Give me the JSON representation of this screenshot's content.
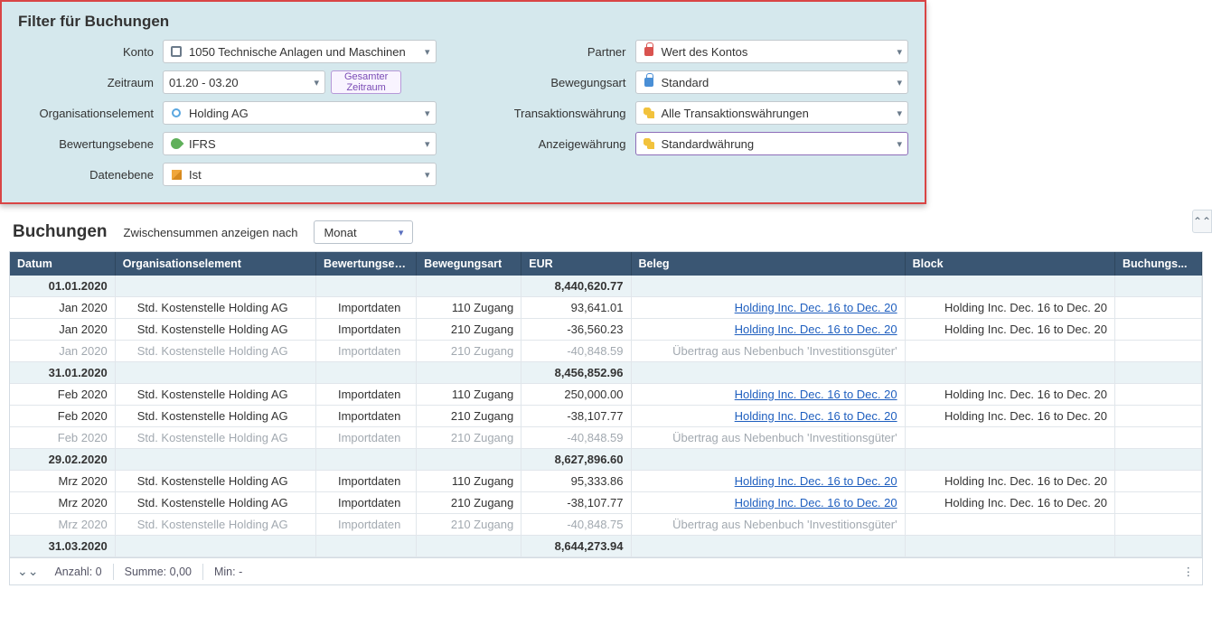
{
  "filter": {
    "title": "Filter für Buchungen",
    "konto": {
      "label": "Konto",
      "value": "1050 Technische Anlagen und Maschinen"
    },
    "zeitraum": {
      "label": "Zeitraum",
      "value": "01.20 - 03.20",
      "button_l1": "Gesamter",
      "button_l2": "Zeitraum"
    },
    "org": {
      "label": "Organisationselement",
      "value": "Holding AG"
    },
    "bewertung": {
      "label": "Bewertungsebene",
      "value": "IFRS"
    },
    "daten": {
      "label": "Datenebene",
      "value": "Ist"
    },
    "partner": {
      "label": "Partner",
      "value": "Wert des Kontos"
    },
    "bewegung": {
      "label": "Bewegungsart",
      "value": "Standard"
    },
    "trans": {
      "label": "Transaktionswährung",
      "value": "Alle Transaktionswährungen"
    },
    "anzeige": {
      "label": "Anzeigewährung",
      "value": "Standardwährung"
    }
  },
  "section": {
    "title": "Buchungen",
    "subtotal_label": "Zwischensummen anzeigen nach",
    "subtotal_value": "Monat"
  },
  "columns": [
    "Datum",
    "Organisationselement",
    "Bewertungseb...",
    "Bewegungsart",
    "EUR",
    "Beleg",
    "Block",
    "Buchungs..."
  ],
  "rows": [
    {
      "type": "subtotal",
      "datum": "01.01.2020",
      "eur": "8,440,620.77"
    },
    {
      "type": "data",
      "datum": "Jan 2020",
      "org": "Std. Kostenstelle Holding AG",
      "bew": "Importdaten",
      "art": "110 Zugang",
      "eur": "93,641.01",
      "beleg": "Holding Inc. Dec. 16 to Dec. 20",
      "block": "Holding Inc. Dec. 16 to Dec. 20"
    },
    {
      "type": "data",
      "datum": "Jan 2020",
      "org": "Std. Kostenstelle Holding AG",
      "bew": "Importdaten",
      "art": "210 Zugang",
      "eur": "-36,560.23",
      "beleg": "Holding Inc. Dec. 16 to Dec. 20",
      "block": "Holding Inc. Dec. 16 to Dec. 20"
    },
    {
      "type": "muted",
      "datum": "Jan 2020",
      "org": "Std. Kostenstelle Holding AG",
      "bew": "Importdaten",
      "art": "210 Zugang",
      "eur": "-40,848.59",
      "beleg": "Übertrag aus Nebenbuch 'Investitionsgüter'",
      "block": ""
    },
    {
      "type": "subtotal",
      "datum": "31.01.2020",
      "eur": "8,456,852.96"
    },
    {
      "type": "data",
      "datum": "Feb 2020",
      "org": "Std. Kostenstelle Holding AG",
      "bew": "Importdaten",
      "art": "110 Zugang",
      "eur": "250,000.00",
      "beleg": "Holding Inc. Dec. 16 to Dec. 20",
      "block": "Holding Inc. Dec. 16 to Dec. 20"
    },
    {
      "type": "data",
      "datum": "Feb 2020",
      "org": "Std. Kostenstelle Holding AG",
      "bew": "Importdaten",
      "art": "210 Zugang",
      "eur": "-38,107.77",
      "beleg": "Holding Inc. Dec. 16 to Dec. 20",
      "block": "Holding Inc. Dec. 16 to Dec. 20"
    },
    {
      "type": "muted",
      "datum": "Feb 2020",
      "org": "Std. Kostenstelle Holding AG",
      "bew": "Importdaten",
      "art": "210 Zugang",
      "eur": "-40,848.59",
      "beleg": "Übertrag aus Nebenbuch 'Investitionsgüter'",
      "block": ""
    },
    {
      "type": "subtotal",
      "datum": "29.02.2020",
      "eur": "8,627,896.60"
    },
    {
      "type": "data",
      "datum": "Mrz 2020",
      "org": "Std. Kostenstelle Holding AG",
      "bew": "Importdaten",
      "art": "110 Zugang",
      "eur": "95,333.86",
      "beleg": "Holding Inc. Dec. 16 to Dec. 20",
      "block": "Holding Inc. Dec. 16 to Dec. 20"
    },
    {
      "type": "data",
      "datum": "Mrz 2020",
      "org": "Std. Kostenstelle Holding AG",
      "bew": "Importdaten",
      "art": "210 Zugang",
      "eur": "-38,107.77",
      "beleg": "Holding Inc. Dec. 16 to Dec. 20",
      "block": "Holding Inc. Dec. 16 to Dec. 20"
    },
    {
      "type": "muted",
      "datum": "Mrz 2020",
      "org": "Std. Kostenstelle Holding AG",
      "bew": "Importdaten",
      "art": "210 Zugang",
      "eur": "-40,848.75",
      "beleg": "Übertrag aus Nebenbuch 'Investitionsgüter'",
      "block": ""
    },
    {
      "type": "subtotal",
      "datum": "31.03.2020",
      "eur": "8,644,273.94"
    }
  ],
  "footer": {
    "anzahl_label": "Anzahl:",
    "anzahl_value": "0",
    "summe_label": "Summe:",
    "summe_value": "0,00",
    "min_label": "Min:",
    "min_value": "-"
  }
}
